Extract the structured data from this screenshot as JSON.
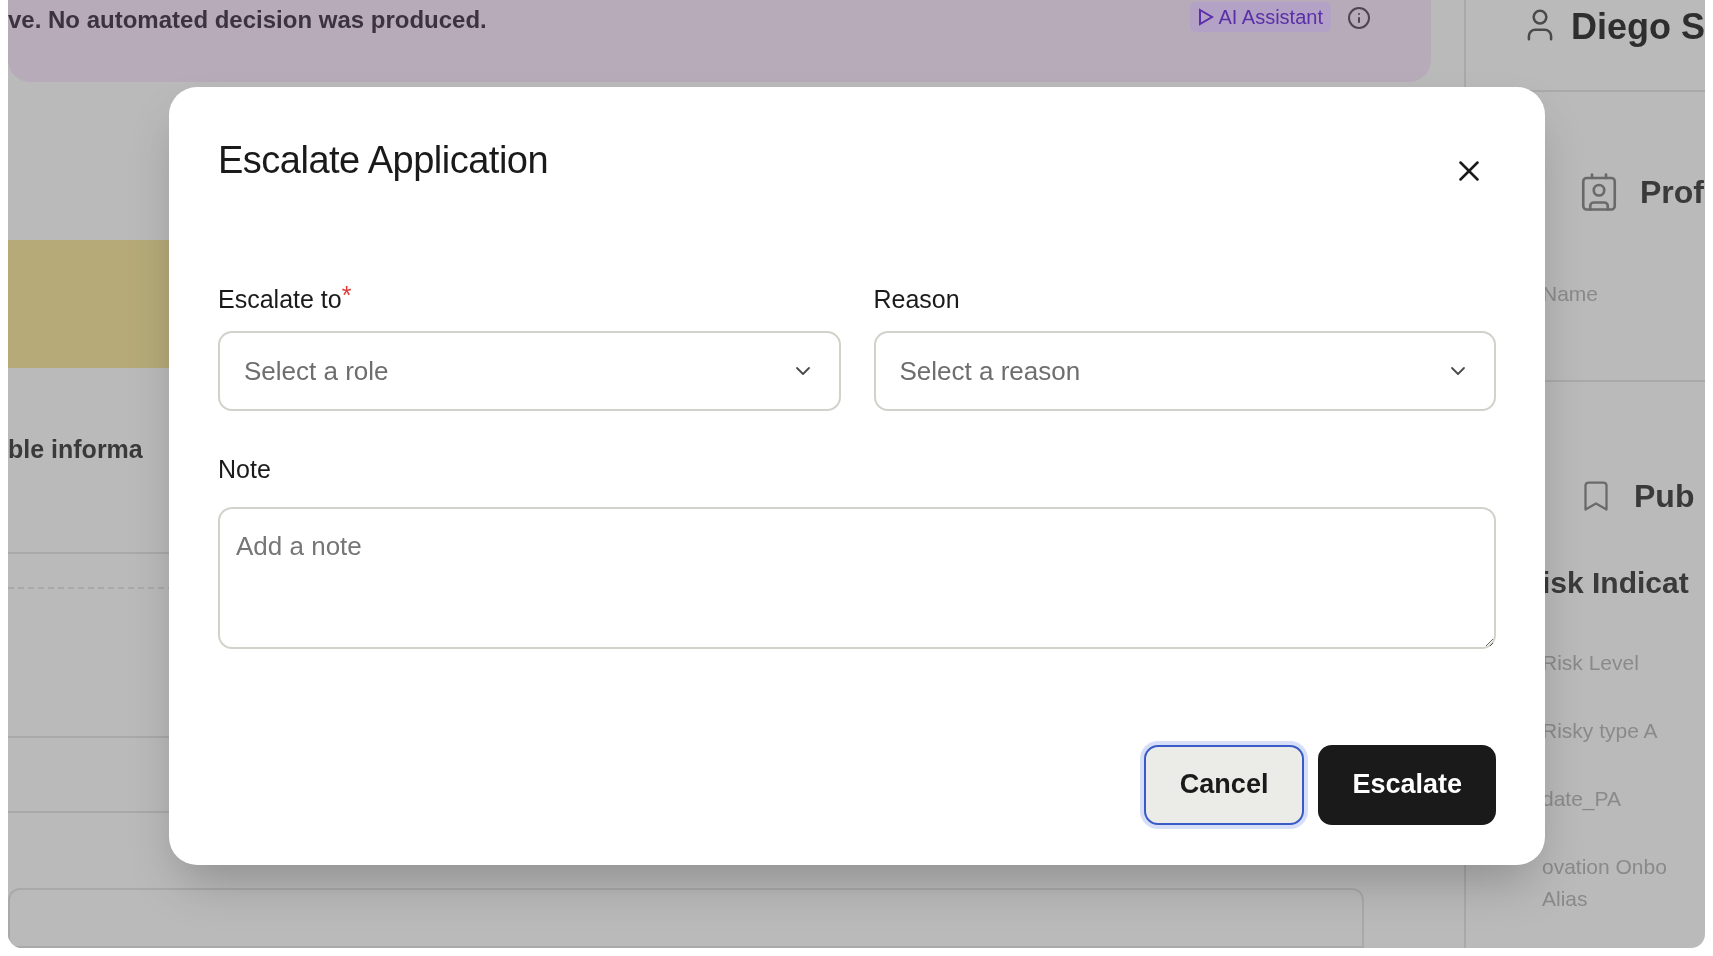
{
  "background": {
    "banner": {
      "text": "ve. No automated decision was produced.",
      "assistant_label": "AI Assistant"
    },
    "user_name": "Diego S",
    "main_heading": "ble informa",
    "sections": [
      {
        "kind": "profile",
        "title": "Prof",
        "fields": [
          "Name"
        ]
      },
      {
        "kind": "bookmark",
        "title": "Pub"
      }
    ],
    "risk_heading": "isk Indicat",
    "risk_rows": [
      "Risk Level",
      "Risky type A",
      "date_PA",
      "ovation Onbo",
      "Alias"
    ]
  },
  "dialog": {
    "title": "Escalate Application",
    "required_mark": "*",
    "fields": [
      {
        "label": "Escalate to",
        "required": true,
        "placeholder": "Select a role"
      },
      {
        "label": "Reason",
        "required": false,
        "placeholder": "Select a reason"
      }
    ],
    "note": {
      "label": "Note",
      "placeholder": "Add a note"
    },
    "buttons": [
      {
        "label": "Cancel",
        "kind": "secondary",
        "focused": true
      },
      {
        "label": "Escalate",
        "kind": "primary",
        "focused": false
      }
    ]
  }
}
